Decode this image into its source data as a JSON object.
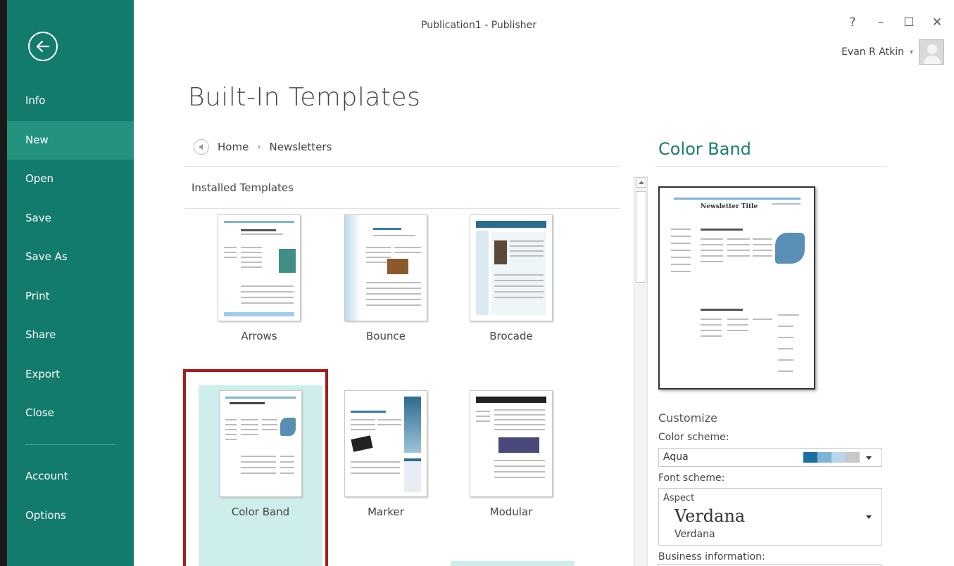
{
  "window": {
    "title": "Publication1 - Publisher",
    "controls": {
      "help": "?",
      "minimize": "–",
      "maximize": "☐",
      "close": "✕"
    },
    "user": {
      "name": "Evan R Atkin",
      "caret": "▾"
    }
  },
  "sidebar": {
    "items": [
      {
        "label": "Info"
      },
      {
        "label": "New",
        "active": true
      },
      {
        "label": "Open"
      },
      {
        "label": "Save"
      },
      {
        "label": "Save As"
      },
      {
        "label": "Print"
      },
      {
        "label": "Share"
      },
      {
        "label": "Export"
      },
      {
        "label": "Close"
      }
    ],
    "bottom_items": [
      {
        "label": "Account"
      },
      {
        "label": "Options"
      }
    ]
  },
  "main": {
    "title": "Built-In Templates",
    "breadcrumb": {
      "home": "Home",
      "separator": "›",
      "current": "Newsletters"
    },
    "section_title": "Installed Templates",
    "templates": [
      {
        "name": "Arrows"
      },
      {
        "name": "Bounce"
      },
      {
        "name": "Brocade"
      },
      {
        "name": "Color Band",
        "selected": true
      },
      {
        "name": "Marker"
      },
      {
        "name": "Modular"
      }
    ]
  },
  "preview": {
    "title": "Color Band",
    "newsletter_title": "Newsletter Title",
    "customize_label": "Customize",
    "color_scheme": {
      "label": "Color scheme:",
      "value": "Aqua",
      "swatches": [
        "#1a6fa3",
        "#7fb3d5",
        "#b9d6ea",
        "#c8c8c8"
      ]
    },
    "font_scheme": {
      "label": "Font scheme:",
      "name": "Aspect",
      "heading_font": "Verdana",
      "body_font": "Verdana"
    },
    "business_info": {
      "label": "Business information:"
    }
  },
  "colors": {
    "sidebar": "#137b6c",
    "accent": "#1f7c70",
    "selection_border": "#a51c1c",
    "selected_bg": "#cdeeea"
  }
}
